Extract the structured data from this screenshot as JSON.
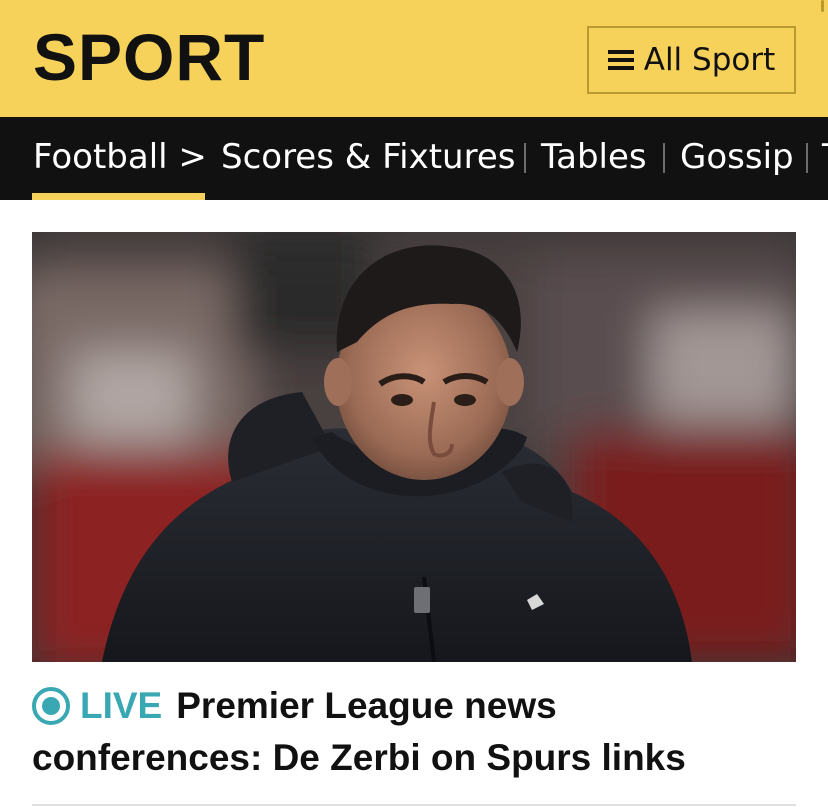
{
  "header": {
    "brand": "SPORT",
    "menu_button_label": "All Sport",
    "menu_icon": "hamburger-menu-icon",
    "background_color": "#f7d25a"
  },
  "nav": {
    "current": "Football >",
    "items": [
      {
        "label": "Scores & Fixtures"
      },
      {
        "label": "Tables"
      },
      {
        "label": "Gossip"
      },
      {
        "label": "T"
      }
    ],
    "background_color": "#111111",
    "active_underline_color": "#f7d25a"
  },
  "article": {
    "live_label": "LIVE",
    "live_icon": "live-indicator-icon",
    "live_color": "#3aa8b3",
    "headline": "Premier League news conferences: De Zerbi on Spurs links"
  }
}
